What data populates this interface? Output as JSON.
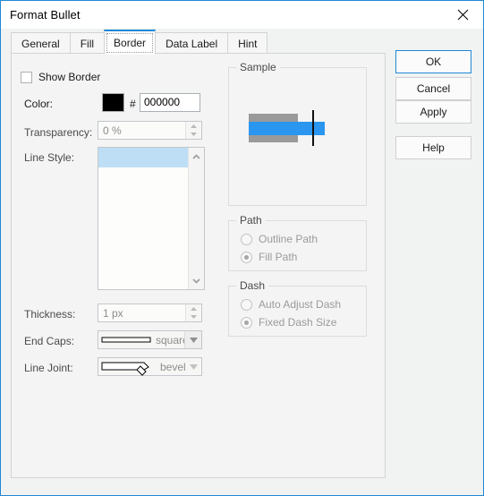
{
  "window": {
    "title": "Format Bullet",
    "close_icon": "close-icon"
  },
  "tabs": [
    {
      "label": "General",
      "active": false
    },
    {
      "label": "Fill",
      "active": false
    },
    {
      "label": "Border",
      "active": true
    },
    {
      "label": "Data Label",
      "active": false
    },
    {
      "label": "Hint",
      "active": false
    }
  ],
  "border": {
    "show_border_label": "Show Border",
    "show_border_checked": false,
    "color_label": "Color:",
    "color_value": "#000000",
    "hash_symbol": "#",
    "color_hex": "000000",
    "transparency_label": "Transparency:",
    "transparency_value": "0 %",
    "line_style_label": "Line Style:",
    "thickness_label": "Thickness:",
    "thickness_value": "1 px",
    "end_caps_label": "End Caps:",
    "end_caps_value": "square",
    "line_joint_label": "Line Joint:",
    "line_joint_value": "bevel"
  },
  "sample": {
    "title": "Sample",
    "bar_gray_color": "#9a9a9a",
    "bar_blue_color": "#2a96ef",
    "tick_color": "#111111"
  },
  "path_group": {
    "title": "Path",
    "options": [
      {
        "label": "Outline Path",
        "selected": false
      },
      {
        "label": "Fill Path",
        "selected": true
      }
    ]
  },
  "dash_group": {
    "title": "Dash",
    "options": [
      {
        "label": "Auto Adjust Dash",
        "selected": false
      },
      {
        "label": "Fixed Dash Size",
        "selected": true
      }
    ]
  },
  "buttons": [
    {
      "label": "OK",
      "primary": true
    },
    {
      "label": "Cancel",
      "primary": false
    },
    {
      "label": "Apply",
      "primary": false
    },
    {
      "label": "Help",
      "primary": false
    }
  ]
}
